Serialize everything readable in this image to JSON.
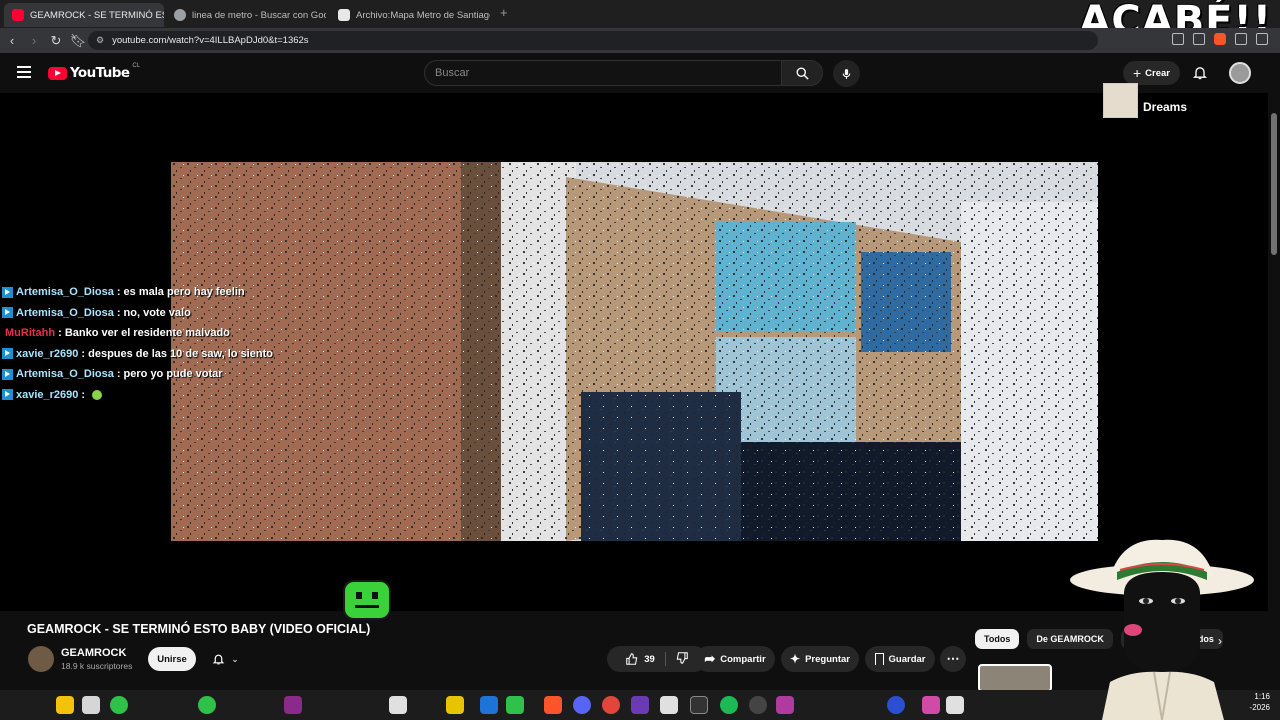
{
  "browser": {
    "tabs": [
      {
        "title": "GEAMROCK - SE TERMINÓ ESTO",
        "active": true,
        "favicon_color": "#ff0033"
      },
      {
        "title": "linea de metro - Buscar con Google",
        "active": false,
        "favicon_color": "#9aa0a6"
      },
      {
        "title": "Archivo:Mapa Metro de Santiago.png",
        "active": false,
        "favicon_color": "#e8e8e8"
      }
    ],
    "url": "youtube.com/watch?v=4ILLBApDJd0&t=1362s"
  },
  "overlay": {
    "headline": "ACABÉ!!"
  },
  "youtube": {
    "logo_text": "YouTube",
    "country_code": "CL",
    "search_placeholder": "Buscar",
    "create_label": "Crear"
  },
  "chat": [
    {
      "user": "Artemisa_O_Diosa",
      "text": ": es mala pero hay feelin",
      "color": "#a8e4ff",
      "badge": true
    },
    {
      "user": "Artemisa_O_Diosa",
      "text": ": no, vote valo",
      "color": "#a8e4ff",
      "badge": true
    },
    {
      "user": "MuRitahh",
      "text": ": Banko ver el residente malvado",
      "color": "#e5304a",
      "badge": false
    },
    {
      "user": "xavie_r2690",
      "text": ": despues de las 10 de saw, lo siento",
      "color": "#a8e4ff",
      "badge": true
    },
    {
      "user": "Artemisa_O_Diosa",
      "text": ": pero yo pude votar",
      "color": "#a8e4ff",
      "badge": true
    },
    {
      "user": "xavie_r2690",
      "text": ":",
      "color": "#a8e4ff",
      "badge": true
    }
  ],
  "video": {
    "title": "GEAMROCK - SE TERMINÓ ESTO BABY (VIDEO OFICIAL)",
    "channel": "GEAMROCK",
    "subscribers": "18.9 k suscriptores",
    "join_label": "Unirse",
    "likes": "39",
    "share_label": "Compartir",
    "ask_label": "Preguntar",
    "save_label": "Guardar"
  },
  "sidebar": {
    "now_playing": "Dreams",
    "chips": [
      "Todos",
      "De GEAMROCK",
      "V",
      "ados"
    ]
  },
  "taskbar": {
    "time": "1:16",
    "date": "-2026"
  }
}
